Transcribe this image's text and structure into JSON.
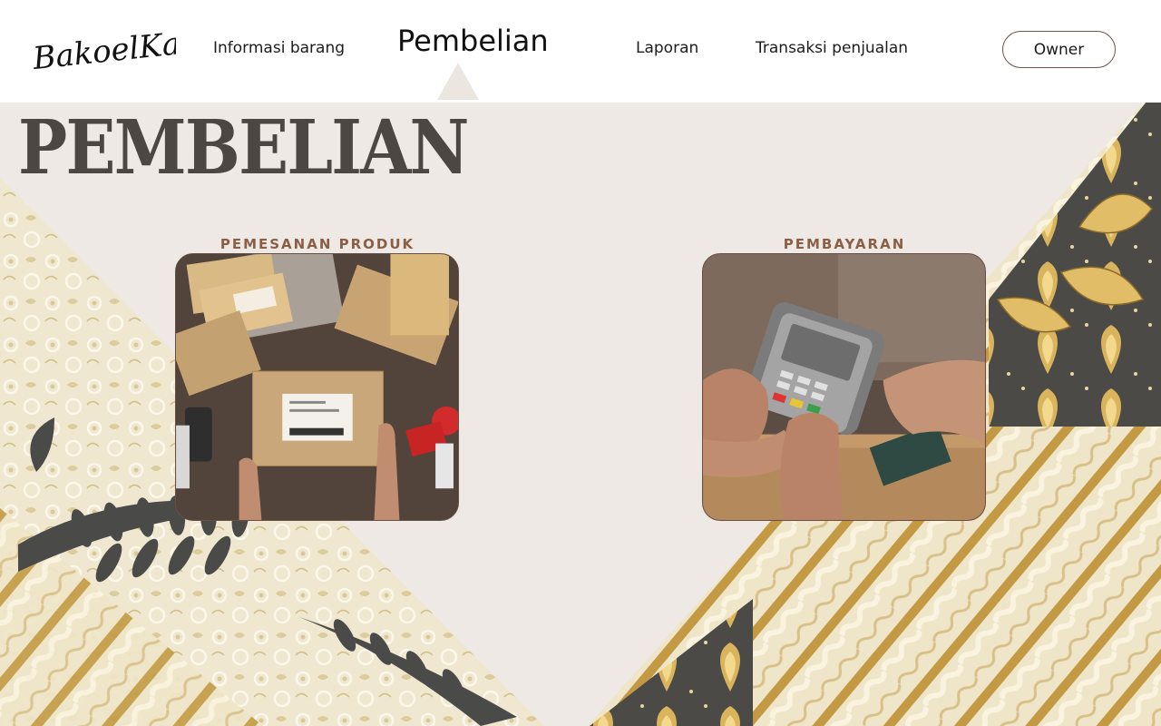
{
  "brand": {
    "logo_text": "BakoelKaos"
  },
  "nav": {
    "items": [
      {
        "label": "Informasi barang"
      },
      {
        "label": "Pembelian",
        "active": true
      },
      {
        "label": "Laporan"
      },
      {
        "label": "Transaksi penjualan"
      }
    ],
    "user_button": "Owner"
  },
  "page": {
    "title": "PEMBELIAN"
  },
  "cards": [
    {
      "label": "PEMESANAN PRODUK",
      "image": "packages-image"
    },
    {
      "label": "PEMBAYARAN",
      "image": "card-payment-image"
    }
  ],
  "colors": {
    "background": "#eee9e5",
    "header": "#ffffff",
    "title": "#4d4744",
    "card_label": "#8a5f45",
    "button_border": "#6b554c",
    "batik_cream": "#efe6cc",
    "batik_gold": "#c9a24a",
    "batik_dark": "#4a4a48"
  }
}
